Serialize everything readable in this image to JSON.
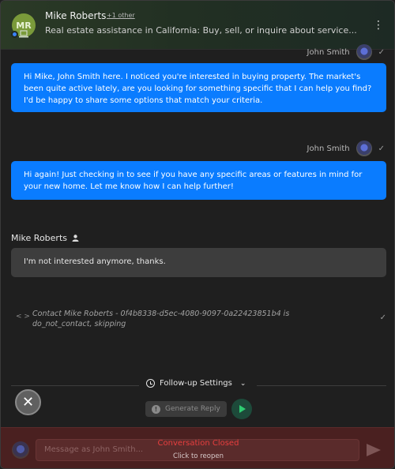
{
  "header": {
    "avatar_initials": "MR",
    "contact_name": "Mike Roberts",
    "other_link": "+1 other",
    "subtitle": "Real estate assistance in California: Buy, sell, or inquire about service...",
    "menu_icon": "kebab-menu-icon"
  },
  "messages": [
    {
      "sender": "John Smith",
      "status_icon": "check-icon",
      "text": "Hi Mike, John Smith here. I noticed you're interested in buying property. The market's been quite active lately, are you looking for something specific that I can help you find? I'd be happy to share some options that match your criteria."
    },
    {
      "sender": "John Smith",
      "status_icon": "check-icon",
      "text": "Hi again! Just checking in to see if you have any specific areas or features in mind for your new home. Let me know how I can help further!"
    }
  ],
  "inbound": {
    "sender": "Mike Roberts",
    "sender_icon": "person-icon",
    "text": "I'm not interested anymore, thanks."
  },
  "system_event": {
    "icon": "code-icon",
    "text": "Contact Mike Roberts - 0f4b8338-d5ec-4080-9097-0a22423851b4 is do_not_contact, skipping"
  },
  "followup": {
    "label": "Follow-up Settings",
    "generate_label": "Generate Reply"
  },
  "footer": {
    "placeholder": "Message as John Smith...",
    "closed_title": "Conversation Closed",
    "reopen_label": "Click to reopen"
  },
  "colors": {
    "outgoing_bubble": "#0a7cff",
    "incoming_bubble": "#3d3d3d",
    "closed_text": "#e83e3e",
    "footer_bg": "#4a2020",
    "avatar_bg": "#7a9a3a"
  }
}
